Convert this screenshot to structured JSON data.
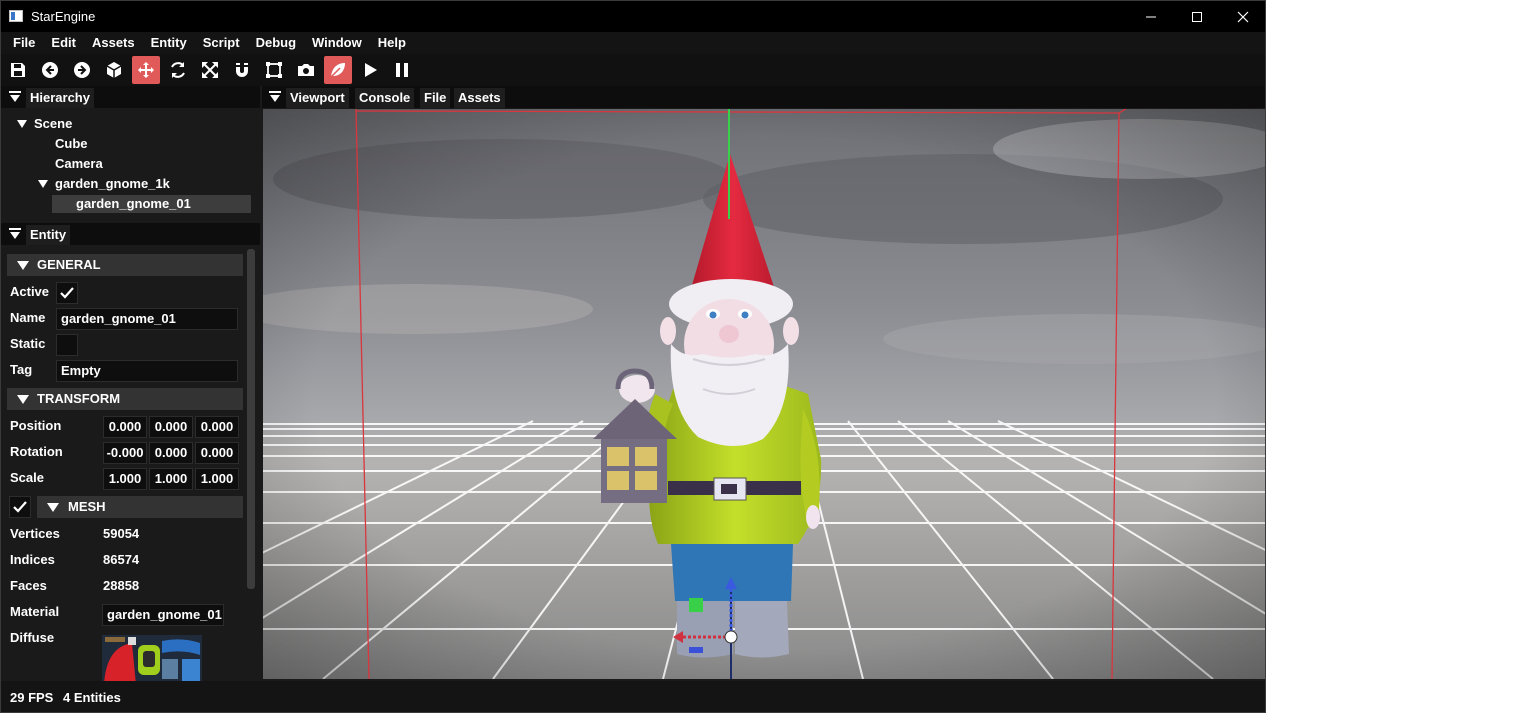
{
  "window": {
    "title": "StarEngine",
    "minimize": "—",
    "maximize": "☐",
    "close": "✕"
  },
  "menu": [
    "File",
    "Edit",
    "Assets",
    "Entity",
    "Script",
    "Debug",
    "Window",
    "Help"
  ],
  "toolbar": {
    "active_tools": [
      "move-tool",
      "leaf-tool"
    ],
    "accent_color": "#e05a5a"
  },
  "hierarchy": {
    "tab": "Hierarchy",
    "nodes": [
      {
        "label": "Scene",
        "expanded": true
      },
      {
        "label": "Cube"
      },
      {
        "label": "Camera"
      },
      {
        "label": "garden_gnome_1k",
        "expanded": true
      },
      {
        "label": "garden_gnome_01",
        "selected": true
      }
    ]
  },
  "entity": {
    "tab": "Entity",
    "general": {
      "header": "GENERAL",
      "active_label": "Active",
      "active": true,
      "name_label": "Name",
      "name": "garden_gnome_01",
      "static_label": "Static",
      "static": false,
      "tag_label": "Tag",
      "tag": "Empty"
    },
    "transform": {
      "header": "TRANSFORM",
      "position_label": "Position",
      "position": [
        "0.000",
        "0.000",
        "0.000"
      ],
      "rotation_label": "Rotation",
      "rotation": [
        "-0.000",
        "0.000",
        "0.000"
      ],
      "scale_label": "Scale",
      "scale": [
        "1.000",
        "1.000",
        "1.000"
      ]
    },
    "mesh": {
      "header": "MESH",
      "enabled": true,
      "vertices_label": "Vertices",
      "vertices": "59054",
      "indices_label": "Indices",
      "indices": "86574",
      "faces_label": "Faces",
      "faces": "28858",
      "material_label": "Material",
      "material": "garden_gnome_01",
      "diffuse_label": "Diffuse"
    }
  },
  "center_tabs": [
    "Viewport",
    "Console",
    "File",
    "Assets"
  ],
  "status": {
    "fps": "29 FPS",
    "entities": "4 Entities"
  }
}
